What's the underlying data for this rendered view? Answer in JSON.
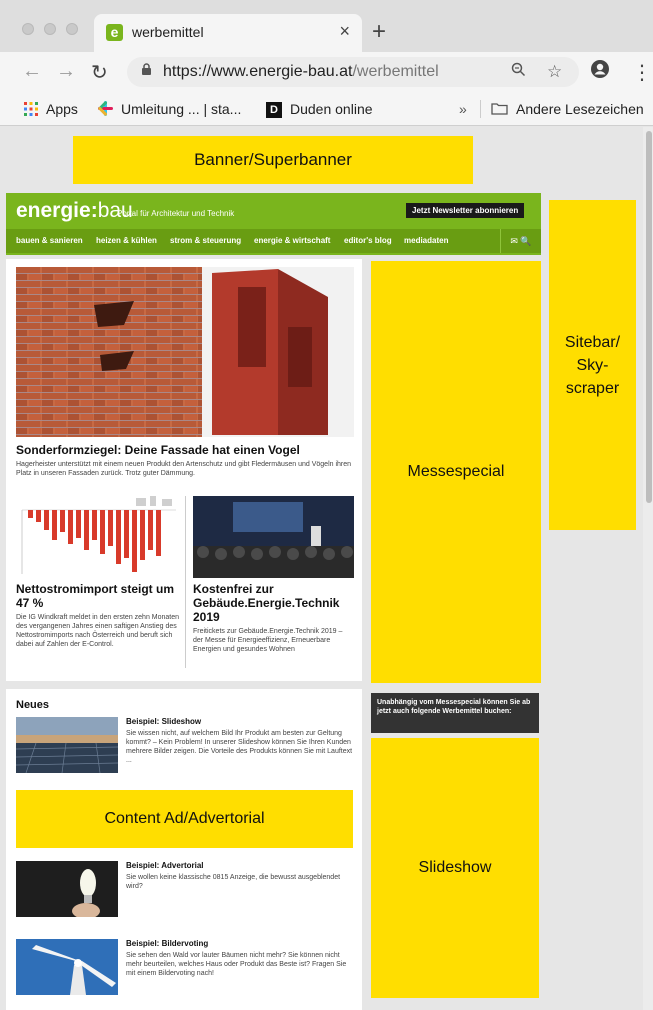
{
  "browser": {
    "tab": {
      "favicon": "e",
      "title": "werbemittel",
      "close": "×"
    },
    "new_tab": "+",
    "url_host": "https://www.energie-bau.at",
    "url_path": "/werbemittel",
    "bookmarks": [
      {
        "label": "Apps",
        "icon": "apps-grid-icon"
      },
      {
        "label": "Umleitung ... | sta...",
        "icon": "slack-icon"
      },
      {
        "label": "Duden online",
        "icon": "duden-icon",
        "icon_text": "D"
      }
    ],
    "overflow": "»",
    "other_bookmarks": "Andere Lesezeichen"
  },
  "ads": {
    "banner": "Banner/Superbanner",
    "skyscraper_lines": [
      "Sitebar/",
      "Sky-",
      "scraper"
    ],
    "messespecial": "Messespecial",
    "content_ad": "Content Ad/Advertorial",
    "slideshow": "Slideshow",
    "info": "Unabhängig vom Messespecial können Sie ab jetzt auch folgende Werbemittel buchen:"
  },
  "site": {
    "logo_bold": "energie:",
    "logo_thin": "bau",
    "tagline": "Portal für Architektur und Technik",
    "newsletter": "Jetzt Newsletter abonnieren",
    "nav": [
      "bauen & sanieren",
      "heizen & kühlen",
      "strom & steuerung",
      "energie & wirtschaft",
      "editor's blog",
      "mediadaten"
    ],
    "nav_icons": "✉ 🔍"
  },
  "articles": {
    "hero_title": "Sonderformziegel: Deine Fassade hat einen Vogel",
    "hero_text": "Hagerheister unterstützt mit einem neuen Produkt den Artenschutz und gibt Fledermäusen und Vögeln ihren Platz in unseren Fassaden zurück. Trotz guter Dämmung.",
    "left_title": "Nettostromimport steigt um 47 %",
    "left_text": "Die IG Windkraft meldet in den ersten zehn Monaten des vergangenen Jahres einen saftigen Anstieg des Nettostromimports nach Österreich und beruft sich dabei auf Zahlen der E-Control.",
    "right_title": "Kostenfrei zur Gebäude.Energie.Technik 2019",
    "right_text": "Freitickets zur Gebäude.Energie.Technik 2019 – der Messe für Energieeffizienz, Erneuerbare Energien und gesundes Wohnen"
  },
  "neues": {
    "heading": "Neues",
    "items": [
      {
        "title": "Beispiel: Slideshow",
        "text": "Sie wissen nicht, auf welchem Bild Ihr Produkt am besten zur Geltung kommt? – Kein Problem! In unserer Slideshow können Sie Ihren Kunden mehrere Bilder zeigen. Die Vorteile des Produkts können Sie mit Lauftext ..."
      },
      {
        "title": "Beispiel: Advertorial",
        "text": "Sie wollen keine klassische 0815 Anzeige, die bewusst ausgeblendet wird?"
      },
      {
        "title": "Beispiel: Bildervoting",
        "text": "Sie sehen den Wald vor lauter Bäumen nicht mehr? Sie können nicht mehr beurteilen, welches Haus oder Produkt das Beste ist? Fragen Sie mit einem Bildervoting nach!"
      }
    ]
  },
  "colors": {
    "brand_green": "#7ab51d",
    "nav_green": "#699d12",
    "ad_yellow": "#ffde00"
  }
}
